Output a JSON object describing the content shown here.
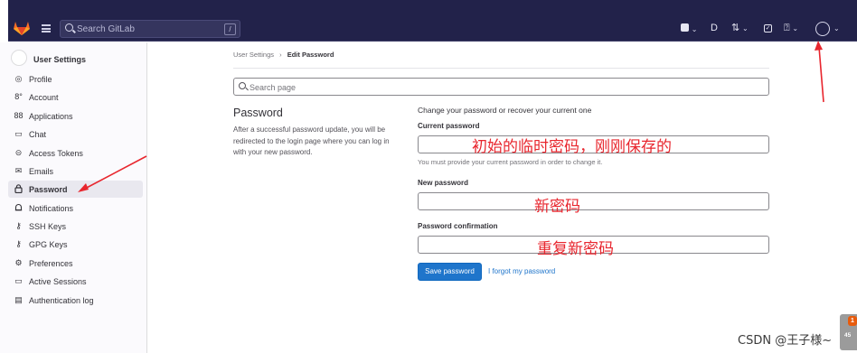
{
  "topbar": {
    "search_placeholder": "Search GitLab",
    "search_shortcut": "/",
    "icons": [
      "issues-icon",
      "merge-requests-icon",
      "todo-icon",
      "help-icon",
      "user-avatar"
    ]
  },
  "sidebar": {
    "title": "User Settings",
    "items": [
      {
        "label": "Profile",
        "icon": "profile-icon",
        "glyph": "◎"
      },
      {
        "label": "Account",
        "icon": "account-icon",
        "glyph": "8°"
      },
      {
        "label": "Applications",
        "icon": "applications-icon",
        "glyph": "88"
      },
      {
        "label": "Chat",
        "icon": "chat-icon",
        "glyph": "▭"
      },
      {
        "label": "Access Tokens",
        "icon": "token-icon",
        "glyph": "⊝"
      },
      {
        "label": "Emails",
        "icon": "mail-icon",
        "glyph": "✉"
      },
      {
        "label": "Password",
        "icon": "lock-icon",
        "glyph": "🔒",
        "active": true
      },
      {
        "label": "Notifications",
        "icon": "bell-icon",
        "glyph": "♫"
      },
      {
        "label": "SSH Keys",
        "icon": "key-icon",
        "glyph": "⚷"
      },
      {
        "label": "GPG Keys",
        "icon": "key-icon",
        "glyph": "⚷"
      },
      {
        "label": "Preferences",
        "icon": "preferences-icon",
        "glyph": "⚙"
      },
      {
        "label": "Active Sessions",
        "icon": "sessions-icon",
        "glyph": "▭"
      },
      {
        "label": "Authentication log",
        "icon": "log-icon",
        "glyph": "▤"
      }
    ]
  },
  "breadcrumb": {
    "parent": "User Settings",
    "separator": "›",
    "current": "Edit Password"
  },
  "page_search": {
    "placeholder": "Search page"
  },
  "section": {
    "title": "Password",
    "description": "After a successful password update, you will be redirected to the login page where you can log in with your new password."
  },
  "form": {
    "heading": "Change your password or recover your current one",
    "current_label": "Current password",
    "current_help": "You must provide your current password in order to change it.",
    "new_label": "New password",
    "confirm_label": "Password confirmation",
    "save_label": "Save password",
    "forgot_label": "I forgot my password"
  },
  "annotations": {
    "current_note": "初始的临时密码，刚刚保存的",
    "new_note": "新密码",
    "confirm_note": "重复新密码",
    "arrow_color": "#e8262e"
  },
  "watermark": "CSDN @王子様~",
  "widget": {
    "badge": "1",
    "count": "45"
  }
}
